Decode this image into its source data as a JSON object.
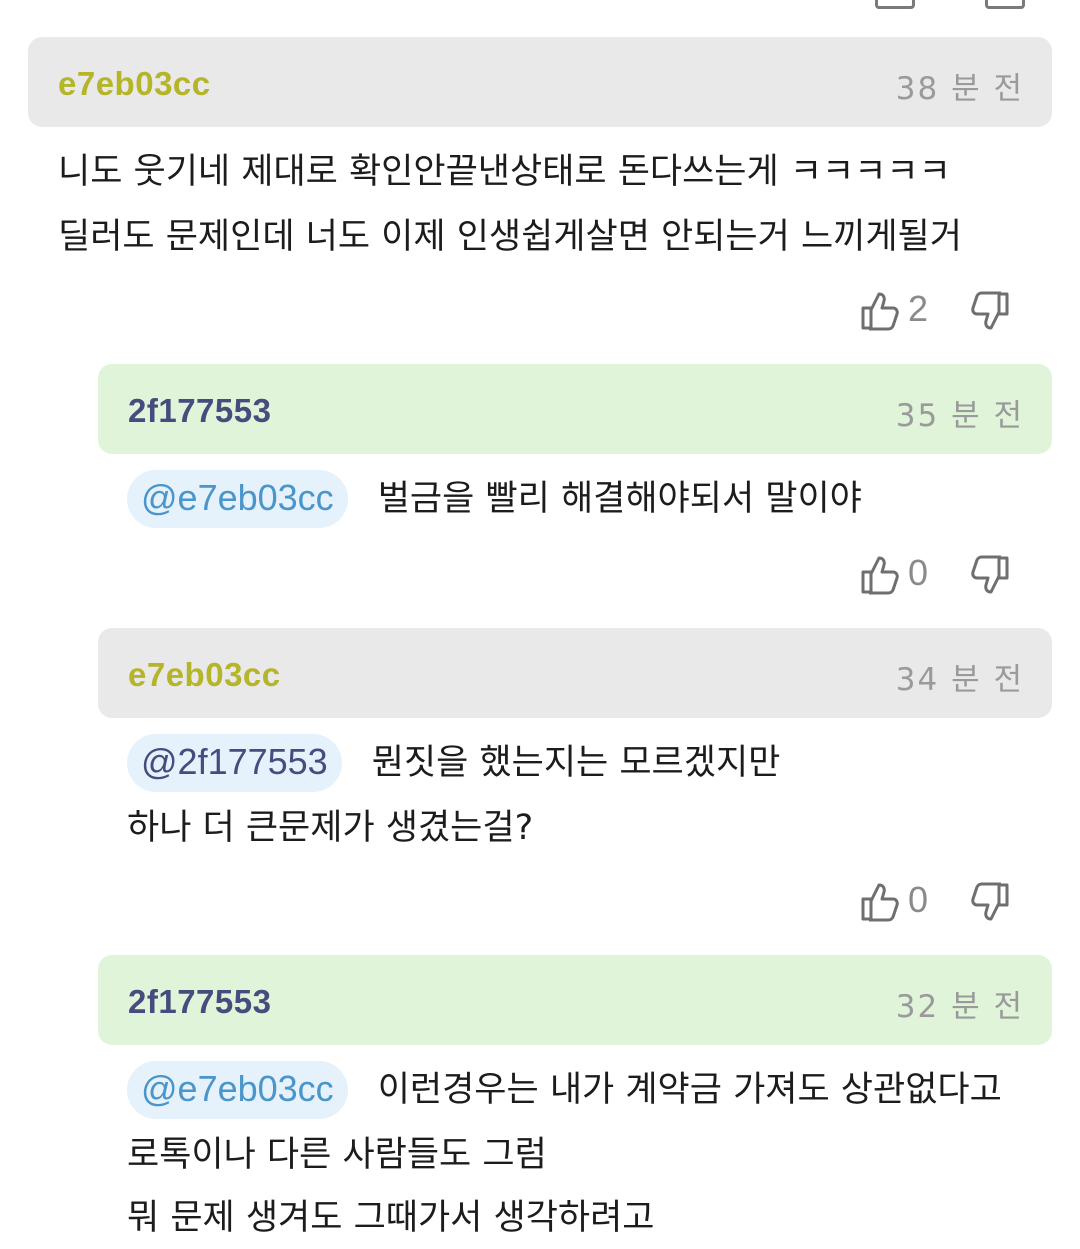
{
  "comments": [
    {
      "author": "e7eb03cc",
      "time": "38 분 전",
      "mention": "",
      "lines": [
        "니도 웃기네 제대로 확인안끝낸상태로 돈다쓰는게 ㅋㅋㅋㅋㅋ",
        "딜러도 문제인데 너도 이제 인생쉽게살면 안되는거 느끼게될거"
      ],
      "likes": "2",
      "header_color": "#e9e9e9",
      "author_color": "#b5b52a"
    },
    {
      "author": "2f177553",
      "time": "35 분 전",
      "mention": "@e7eb03cc",
      "lines": [
        "벌금을 빨리 해결해야되서 말이야"
      ],
      "likes": "0",
      "header_color": "#dff4d8",
      "author_color": "#474b7d"
    },
    {
      "author": "e7eb03cc",
      "time": "34 분 전",
      "mention": "@2f177553",
      "lines": [
        "뭔짓을 했는지는 모르겠지만",
        "하나 더 큰문제가 생겼는걸?"
      ],
      "likes": "0",
      "header_color": "#e9e9e9",
      "author_color": "#b5b52a"
    },
    {
      "author": "2f177553",
      "time": "32 분 전",
      "mention": "@e7eb03cc",
      "lines": [
        "이런경우는 내가 계약금 가져도 상관없다고",
        "로톡이나 다른 사람들도 그럼",
        "뭐 문제 생겨도 그때가서 생각하려고"
      ],
      "likes": "",
      "header_color": "#dff4d8",
      "author_color": "#474b7d"
    }
  ]
}
